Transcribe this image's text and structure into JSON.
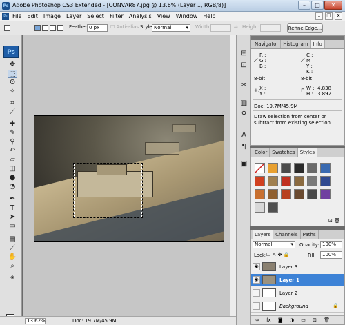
{
  "window": {
    "title": "Adobe Photoshop CS3 Extended - [CONVAR87.jpg @ 13.6% (Layer 1, RGB/8)]",
    "app_icon": "Ps",
    "min": "–",
    "max": "□",
    "close": "✕"
  },
  "menu": [
    "File",
    "Edit",
    "Image",
    "Layer",
    "Select",
    "Filter",
    "Analysis",
    "View",
    "Window",
    "Help"
  ],
  "options": {
    "feather_label": "Feather:",
    "feather_value": "0 px",
    "antialias": "Anti-alias",
    "style_label": "Style:",
    "style_value": "Normal",
    "width_label": "Width:",
    "height_label": "Height:",
    "refine_edge": "Refine Edge..."
  },
  "tools": {
    "logo": "Ps"
  },
  "status": {
    "zoom": "13.62%",
    "doc": "Doc: 19.7M/45.9M"
  },
  "info_panel": {
    "tabs": [
      "Navigator",
      "Histogram",
      "Info"
    ],
    "active_tab": "Info",
    "r": "R :",
    "g": "G :",
    "b": "B :",
    "c": "C :",
    "m": "M :",
    "y": "Y :",
    "k": "K :",
    "bit_left": "8-bit",
    "bit_right": "8-bit",
    "x": "X :",
    "y2": "Y :",
    "w": "W :",
    "h": "H :",
    "w_val": "4.838",
    "h_val": "3.892",
    "doc": "Doc: 19.7M/45.9M",
    "hint": "Draw selection from center or subtract from existing selection."
  },
  "styles_panel": {
    "tabs": [
      "Color",
      "Swatches",
      "Styles"
    ],
    "active_tab": "Styles",
    "swatch_colors": [
      "#ffffff",
      "#e8a030",
      "#4a4a4a",
      "#2a2a2a",
      "#6a6a6a",
      "#3a6ab0",
      "#d04020",
      "#a08050",
      "#c03020",
      "#8a6a40",
      "#7a7a7a",
      "#304a90",
      "#c87030",
      "#906030",
      "#b84020",
      "#6a4a30",
      "#4a4a4a",
      "#7040a0",
      "#d8d8d8",
      "#505050"
    ]
  },
  "layers_panel": {
    "tabs": [
      "Layers",
      "Channels",
      "Paths"
    ],
    "active_tab": "Layers",
    "blend_mode": "Normal",
    "opacity_label": "Opacity:",
    "opacity_value": "100%",
    "lock_label": "Lock:",
    "fill_label": "Fill:",
    "fill_value": "100%",
    "layers": [
      {
        "name": "Layer 3",
        "visible": true,
        "selected": false
      },
      {
        "name": "Layer 1",
        "visible": true,
        "selected": true
      },
      {
        "name": "Layer 2",
        "visible": false,
        "selected": false
      },
      {
        "name": "Background",
        "visible": false,
        "selected": false
      }
    ]
  }
}
